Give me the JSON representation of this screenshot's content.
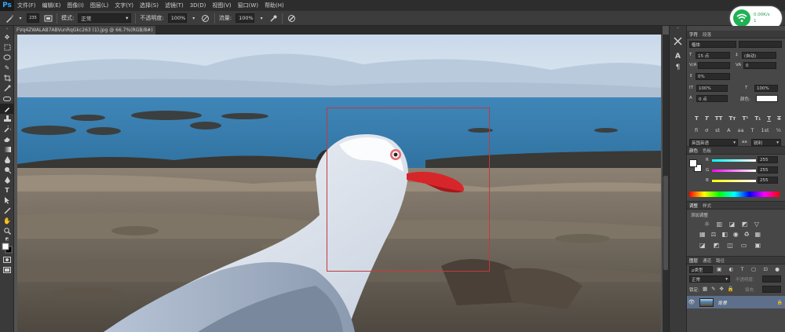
{
  "app": {
    "logo": "Ps"
  },
  "menu": [
    "文件(F)",
    "编辑(E)",
    "图像(I)",
    "图层(L)",
    "文字(Y)",
    "选择(S)",
    "滤镜(T)",
    "3D(D)",
    "视图(V)",
    "窗口(W)",
    "帮助(H)"
  ],
  "options": {
    "brush_size": "235",
    "mode_label": "模式:",
    "mode_value": "正常",
    "opacity_label": "不透明度:",
    "opacity_value": "100%",
    "flow_label": "流量:",
    "flow_value": "100%"
  },
  "network": {
    "speed": "0.00K/s",
    "count": "1"
  },
  "document": {
    "tab_title": "FVq4ZWALAB7ABVunRqGkc263 (1).jpg @ 66.7%(RGB/8#)"
  },
  "character_panel": {
    "tabs": [
      "字符",
      "段落"
    ],
    "font_style": "楷体",
    "font_size": "15 点",
    "leading": "(自动)",
    "tracking": "0",
    "kerning": "0%",
    "vscale": "100%",
    "hscale": "100%",
    "baseline": "0 点",
    "color_label": "颜色:",
    "aa_label": "英国英语",
    "aa_value": "锐利"
  },
  "color_panel": {
    "tabs": [
      "颜色",
      "色板"
    ],
    "r": "255",
    "g": "255",
    "b": "255",
    "r_label": "R",
    "g_label": "G",
    "b_label": "B"
  },
  "adjustments_panel": {
    "tabs": [
      "调整",
      "样式"
    ],
    "title": "添加调整"
  },
  "layers_panel": {
    "tabs": [
      "图层",
      "通道",
      "路径"
    ],
    "filter": "ρ类型",
    "blend": "正常",
    "opacity_label": "不透明度:",
    "lock_label": "锁定:",
    "fill_label": "填充:",
    "layer_name": "背景"
  }
}
